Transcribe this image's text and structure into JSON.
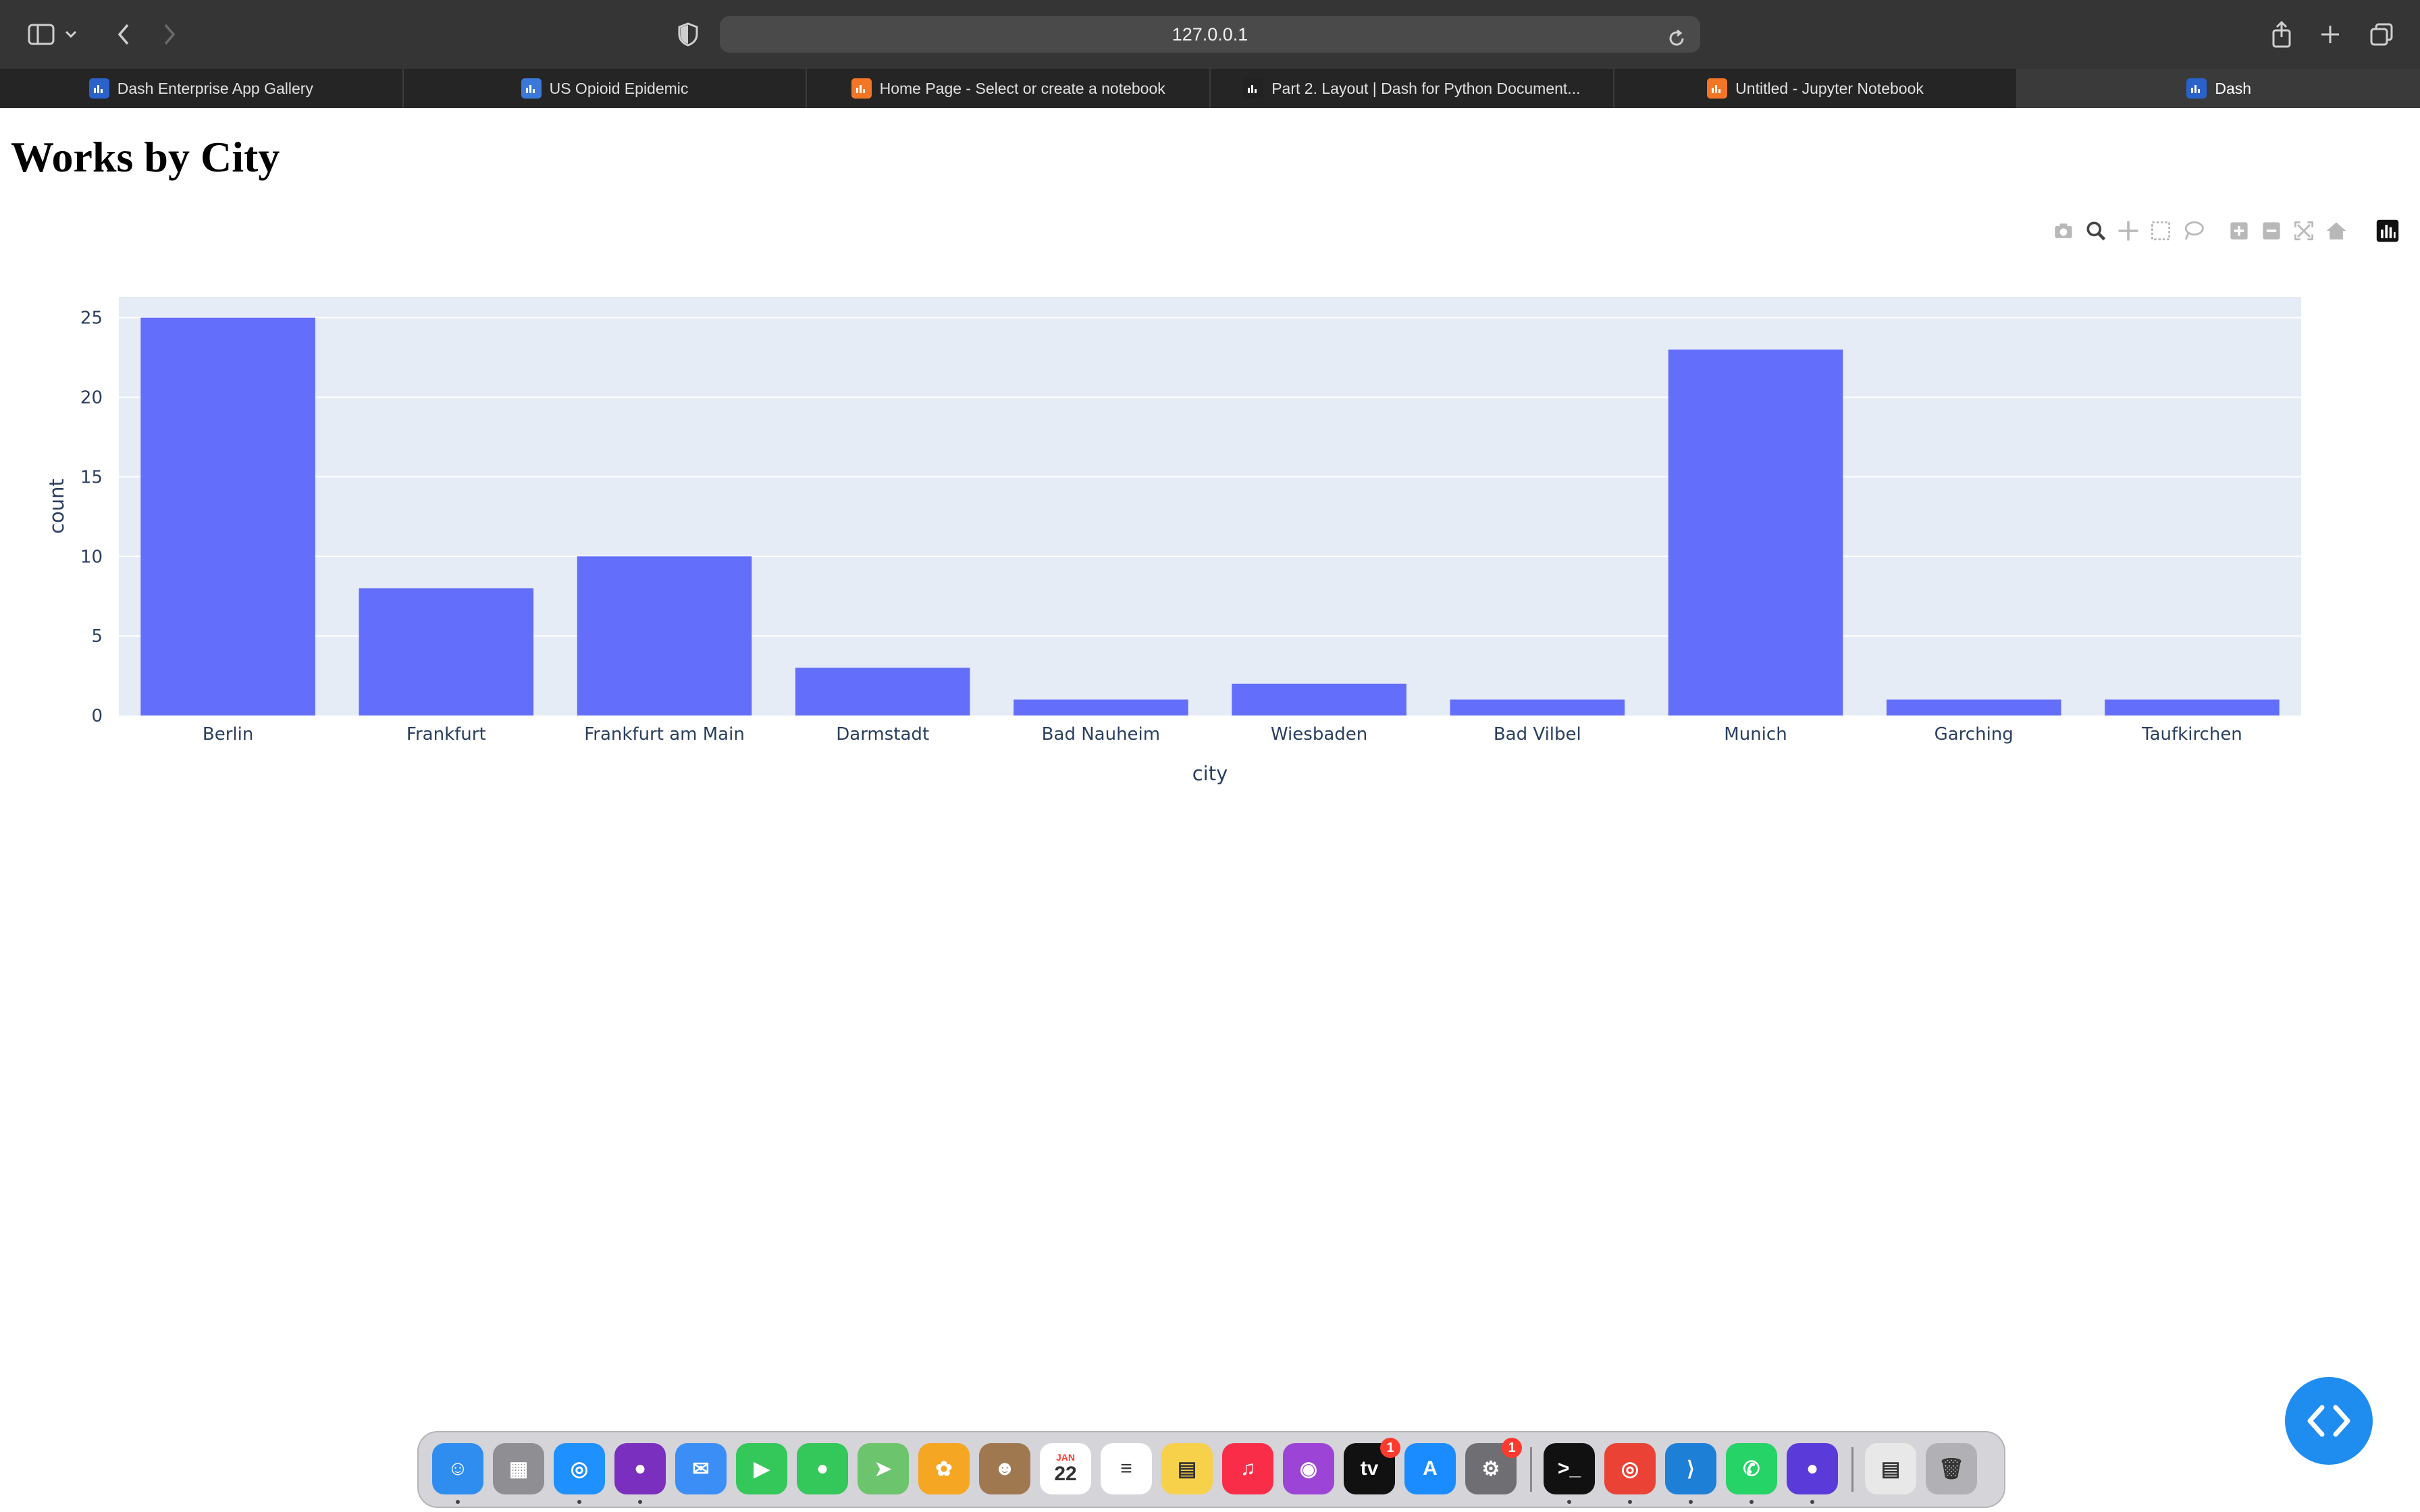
{
  "browser": {
    "url": "127.0.0.1",
    "tabs": [
      {
        "label": "Dash Enterprise App Gallery",
        "icon": "dash-app-icon",
        "color": "#2a62c9"
      },
      {
        "label": "US Opioid Epidemic",
        "icon": "dash-app-icon",
        "color": "#3c78d8"
      },
      {
        "label": "Home Page - Select or create a notebook",
        "icon": "jupyter-icon",
        "color": "#f37626"
      },
      {
        "label": "Part 2. Layout | Dash for Python Document...",
        "icon": "plotly-docs-icon",
        "color": "#222222"
      },
      {
        "label": "Untitled - Jupyter Notebook",
        "icon": "notebook-icon",
        "color": "#f37626"
      },
      {
        "label": "Dash",
        "icon": "dash-app-icon",
        "color": "#2a62c9"
      }
    ]
  },
  "page": {
    "title": "Works by City"
  },
  "modebar": [
    "camera-icon",
    "zoom-icon",
    "pan-icon",
    "box-select-icon",
    "lasso-icon",
    "zoom-in-icon",
    "zoom-out-icon",
    "autoscale-icon",
    "reset-axes-icon",
    "plotly-logo-icon"
  ],
  "chart_data": {
    "type": "bar",
    "categories": [
      "Berlin",
      "Frankfurt",
      "Frankfurt am Main",
      "Darmstadt",
      "Bad Nauheim",
      "Wiesbaden",
      "Bad Vilbel",
      "Munich",
      "Garching",
      "Taufkirchen"
    ],
    "values": [
      25,
      8,
      10,
      3,
      1,
      2,
      1,
      23,
      1,
      1
    ],
    "title": "",
    "xlabel": "city",
    "ylabel": "count",
    "ylim": [
      0,
      26.3
    ],
    "yticks": [
      0,
      5,
      10,
      15,
      20,
      25
    ],
    "grid": true,
    "bar_color": "#636efa",
    "plot_bg": "#e5ecf6"
  },
  "dock": {
    "apps": [
      {
        "name": "finder-icon",
        "color": "#2f8df0",
        "glyph": "☺",
        "running": true
      },
      {
        "name": "launchpad-icon",
        "color": "#8e8e93",
        "glyph": "▦",
        "running": false
      },
      {
        "name": "safari-icon",
        "color": "#1e90ff",
        "glyph": "◎",
        "running": true
      },
      {
        "name": "firefox-icon",
        "color": "#7b2fbe",
        "glyph": "●",
        "running": true
      },
      {
        "name": "mail-icon",
        "color": "#3a8ef6",
        "glyph": "✉",
        "running": false
      },
      {
        "name": "facetime-icon",
        "color": "#34c759",
        "glyph": "▶",
        "running": false
      },
      {
        "name": "messages-icon",
        "color": "#34c759",
        "glyph": "●",
        "running": false
      },
      {
        "name": "maps-icon",
        "color": "#6cc46c",
        "glyph": "➤",
        "running": false
      },
      {
        "name": "photos-icon",
        "color": "#f5a623",
        "glyph": "✿",
        "running": false
      },
      {
        "name": "contacts-icon",
        "color": "#a07850",
        "glyph": "☻",
        "running": false
      },
      {
        "name": "calendar-icon",
        "color": "#ffffff",
        "glyph": "22",
        "label": "JAN",
        "running": false
      },
      {
        "name": "reminders-icon",
        "color": "#ffffff",
        "glyph": "≡",
        "running": false
      },
      {
        "name": "notes-icon",
        "color": "#f7d14a",
        "glyph": "▤",
        "running": false
      },
      {
        "name": "music-icon",
        "color": "#fa2d48",
        "glyph": "♫",
        "running": false
      },
      {
        "name": "podcasts-icon",
        "color": "#9b44d6",
        "glyph": "◉",
        "running": false
      },
      {
        "name": "apple-tv-icon",
        "color": "#111111",
        "glyph": "tv",
        "badge": "1",
        "running": false
      },
      {
        "name": "app-store-icon",
        "color": "#1a8cff",
        "glyph": "A",
        "running": false
      },
      {
        "name": "system-preferences-icon",
        "color": "#6e6e73",
        "glyph": "⚙",
        "badge": "1",
        "running": false
      },
      {
        "name": "terminal-icon",
        "color": "#111111",
        "glyph": ">_",
        "running": true
      },
      {
        "name": "chrome-icon",
        "color": "#ea4335",
        "glyph": "◎",
        "running": true
      },
      {
        "name": "vscode-icon",
        "color": "#1e7fd6",
        "glyph": "⟩",
        "running": true
      },
      {
        "name": "whatsapp-icon",
        "color": "#25d366",
        "glyph": "✆",
        "running": true
      },
      {
        "name": "firefox-dev-icon",
        "color": "#5a3bd9",
        "glyph": "●",
        "running": true
      },
      {
        "name": "documents-icon",
        "color": "#e8e8e8",
        "glyph": "▤",
        "running": false
      },
      {
        "name": "trash-icon",
        "color": "#b0b0b5",
        "glyph": "🗑",
        "running": false
      }
    ]
  }
}
